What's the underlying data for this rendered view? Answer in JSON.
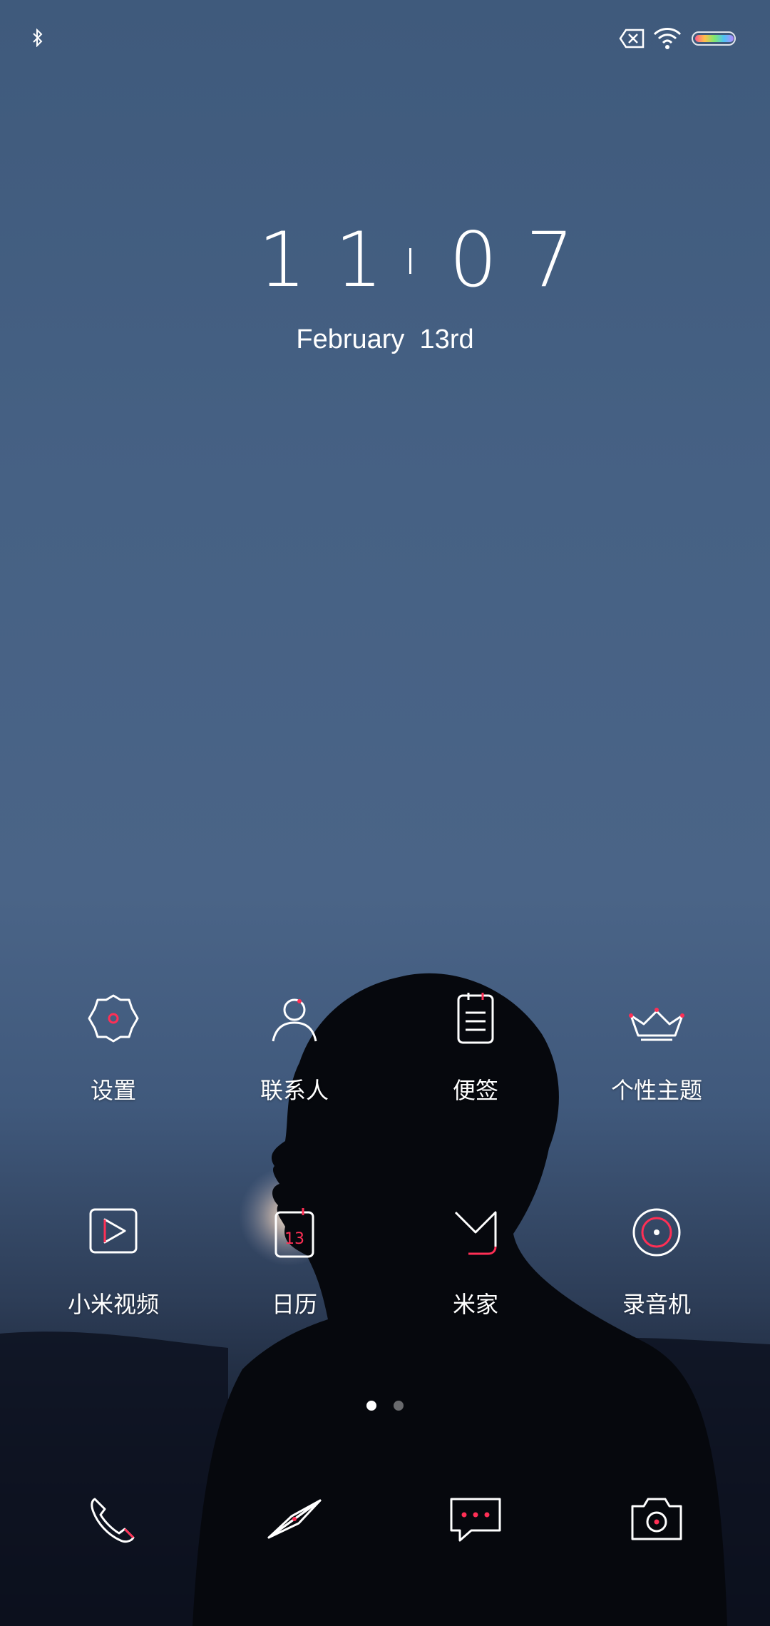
{
  "clock": {
    "hours": "11",
    "minutes": "07"
  },
  "date": "February  13rd",
  "apps": [
    {
      "label": "设置",
      "icon": "gear-icon"
    },
    {
      "label": "联系人",
      "icon": "contact-icon"
    },
    {
      "label": "便签",
      "icon": "notes-icon"
    },
    {
      "label": "个性主题",
      "icon": "crown-icon"
    },
    {
      "label": "小米视频",
      "icon": "video-icon"
    },
    {
      "label": "日历",
      "icon": "calendar-icon",
      "calendar_day": "13"
    },
    {
      "label": "米家",
      "icon": "mijia-icon"
    },
    {
      "label": "录音机",
      "icon": "recorder-icon"
    }
  ],
  "dock": [
    "phone-icon",
    "browser-icon",
    "messages-icon",
    "camera-icon"
  ],
  "status_bar": {
    "icons": [
      "bluetooth-icon",
      "no-sim-icon",
      "wifi-icon",
      "battery-icon"
    ]
  },
  "colors": {
    "accent": "#ff2f55",
    "icon_stroke": "#ffffff"
  }
}
